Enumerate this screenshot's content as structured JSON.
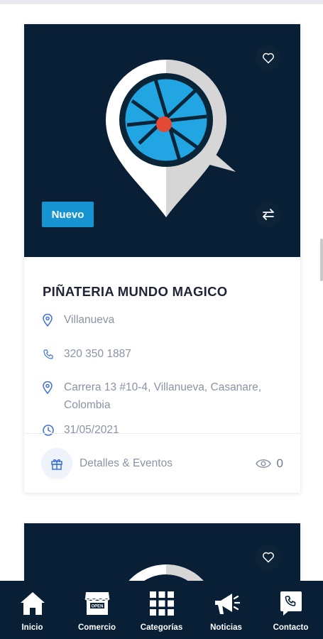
{
  "card": {
    "badge": "Nuevo",
    "title": "PIÑATERIA MUNDO MAGICO",
    "city": "Villanueva",
    "phone": "320 350 1887",
    "address": "Carrera 13 #10-4, Villanueva, Casanare, Colombia",
    "date": "31/05/2021",
    "details_label": "Detalles & Eventos",
    "views": "0"
  },
  "nav": {
    "items": [
      {
        "label": "Inicio",
        "icon": "home-icon"
      },
      {
        "label": "Comercio",
        "icon": "store-icon"
      },
      {
        "label": "Categorías",
        "icon": "grid-icon"
      },
      {
        "label": "Noticias",
        "icon": "megaphone-icon"
      },
      {
        "label": "Contacto",
        "icon": "phone-icon"
      }
    ]
  },
  "colors": {
    "hero_bg": "#081f36",
    "accent": "#1594d1",
    "nav_bg": "#081f36",
    "text_muted": "#8a93a6"
  }
}
